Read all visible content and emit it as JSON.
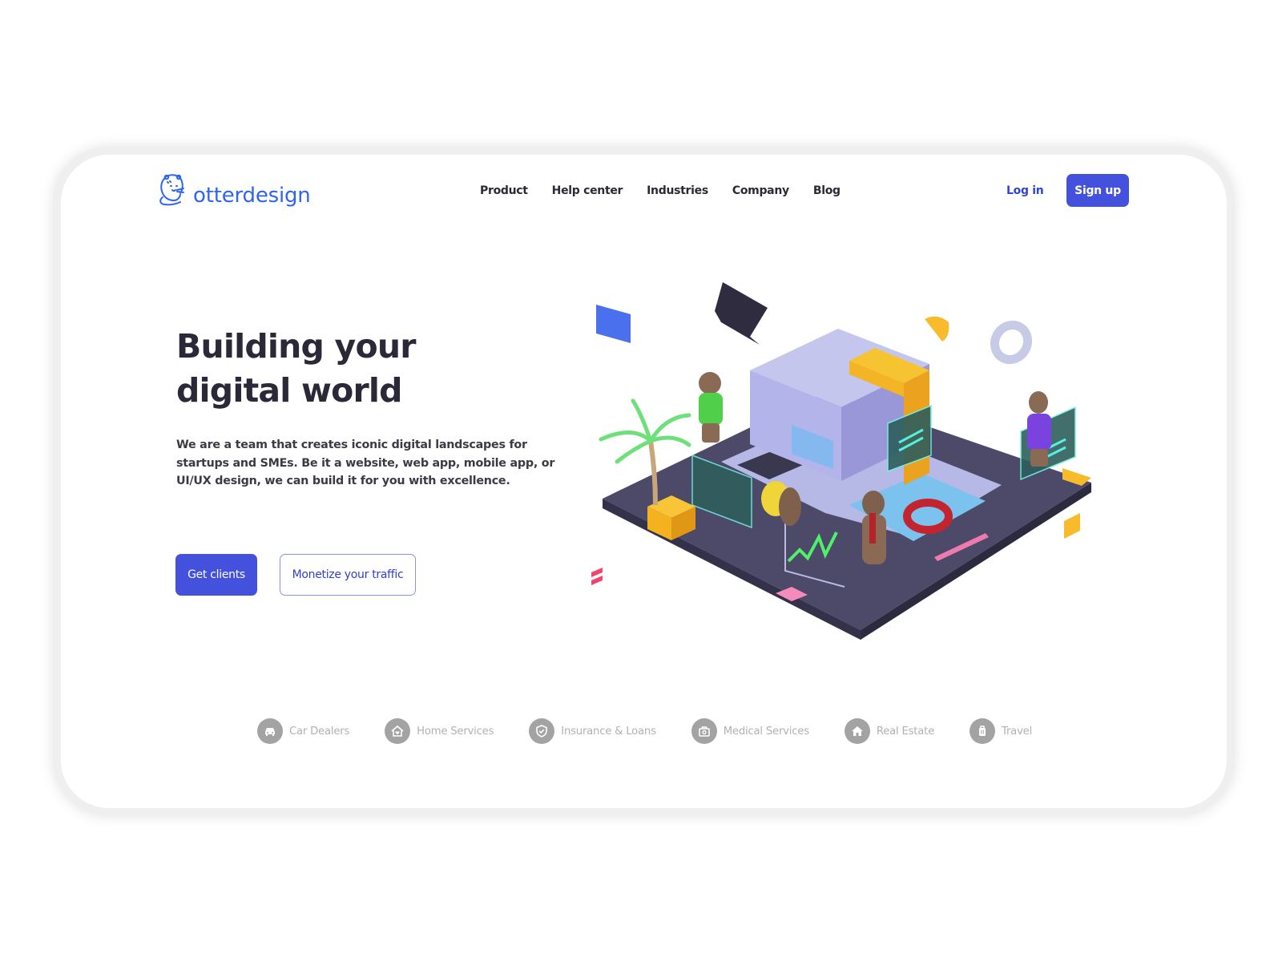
{
  "brand": {
    "name": "otterdesign",
    "logo_icon": "otter-mascot-icon",
    "color": "#2e64f0"
  },
  "nav": {
    "items": [
      {
        "label": "Product"
      },
      {
        "label": "Help center"
      },
      {
        "label": "Industries"
      },
      {
        "label": "Company"
      },
      {
        "label": "Blog"
      }
    ],
    "login_label": "Log in",
    "signup_label": "Sign up"
  },
  "hero": {
    "title_line1": "Building your",
    "title_line2": "digital world",
    "description": "We are a team that creates iconic digital landscapes for startups and SMEs. Be it a website, web app, mobile app, or UI/UX design, we can build it for you with excellence.",
    "primary_cta": "Get clients",
    "secondary_cta": "Monetize your traffic",
    "illustration": "isometric-office-with-otters"
  },
  "industries": [
    {
      "label": "Car Dealers",
      "icon": "car-icon"
    },
    {
      "label": "Home Services",
      "icon": "home-heart-icon"
    },
    {
      "label": "Insurance & Loans",
      "icon": "shield-check-icon"
    },
    {
      "label": "Medical Services",
      "icon": "medical-bag-icon"
    },
    {
      "label": "Real Estate",
      "icon": "house-icon"
    },
    {
      "label": "Travel",
      "icon": "luggage-icon"
    }
  ],
  "colors": {
    "accent": "#4351dc",
    "heading": "#2b2838",
    "muted": "#b1b1b1",
    "icon_bg": "#a3a3a3"
  }
}
